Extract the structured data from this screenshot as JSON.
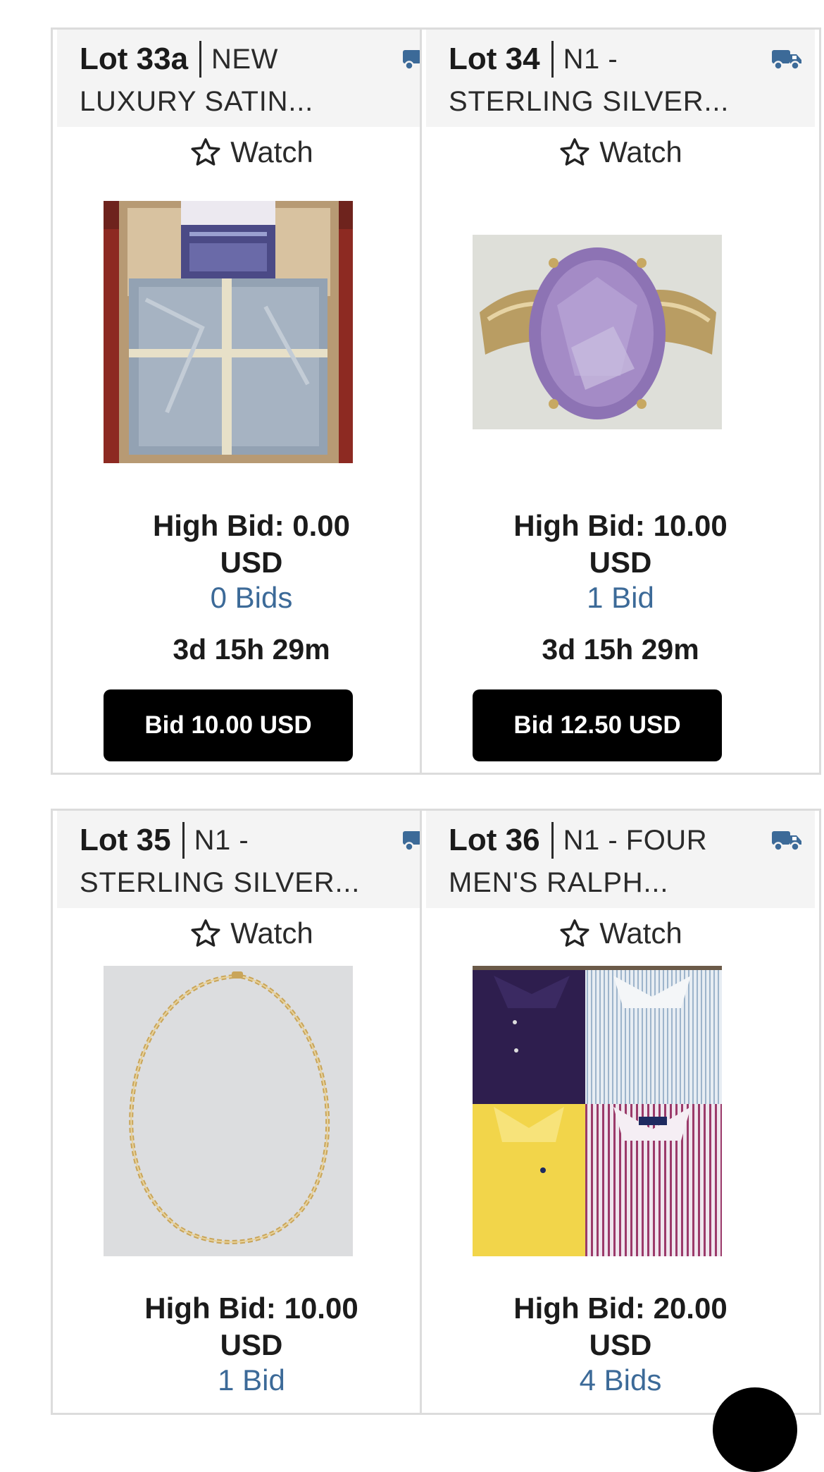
{
  "lots": [
    {
      "lot": "Lot 33a",
      "title_start": "NEW",
      "title_rest": "LUXURY SATIN...",
      "watch": "Watch",
      "high_bid": "High Bid: 0.00",
      "currency": "USD",
      "bids": "0 Bids",
      "time_left": "3d 15h 29m",
      "bid_button": "Bid 10.00 USD"
    },
    {
      "lot": "Lot 34",
      "title_start": "N1 -",
      "title_rest": "STERLING SILVER...",
      "watch": "Watch",
      "high_bid": "High Bid: 10.00",
      "currency": "USD",
      "bids": "1 Bid",
      "time_left": "3d 15h 29m",
      "bid_button": "Bid 12.50 USD"
    },
    {
      "lot": "Lot 35",
      "title_start": "N1 -",
      "title_rest": "STERLING SILVER...",
      "watch": "Watch",
      "high_bid": "High Bid: 10.00",
      "currency": "USD",
      "bids": "1 Bid"
    },
    {
      "lot": "Lot 36",
      "title_start": "N1 - FOUR",
      "title_rest": "MEN'S RALPH...",
      "watch": "Watch",
      "high_bid": "High Bid: 20.00",
      "currency": "USD",
      "bids": "4 Bids"
    }
  ],
  "colors": {
    "accent": "#3c6a98",
    "button": "#000000",
    "header_bg": "#f4f4f4"
  }
}
